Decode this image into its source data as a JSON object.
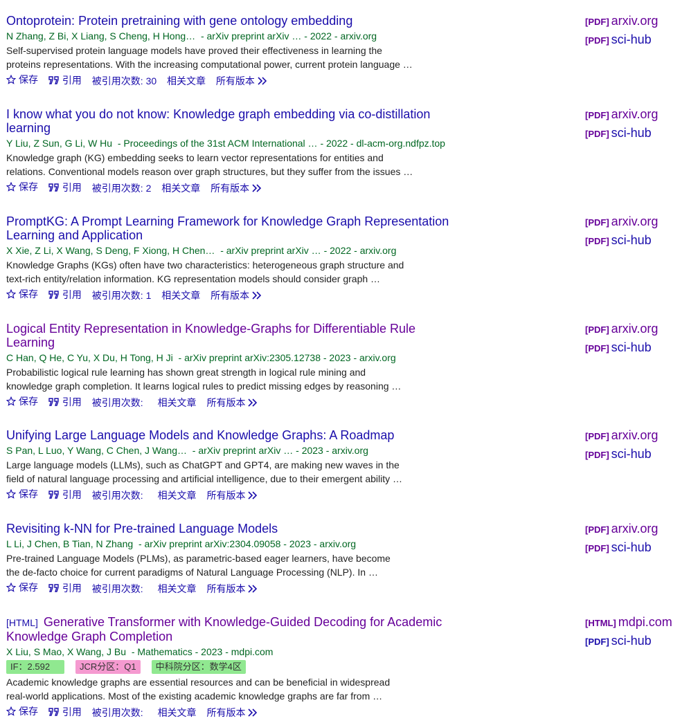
{
  "ui": {
    "save": "保存",
    "cite": "引用",
    "cited_by_prefix": "被引用次数:",
    "related": "相关文章",
    "all_versions": "所有版本",
    "pdf_tag": "[PDF]",
    "html_tag": "[HTML]"
  },
  "results": [
    {
      "title": "Ontoprotein: Protein pretraining with gene ontology embedding",
      "authors": [
        "N Zhang",
        "Z Bi",
        "X Liang",
        "S Cheng",
        "H Hong"
      ],
      "authors_more": "…",
      "source": "- arXiv preprint arXiv … - 2022 - arxiv.org",
      "snippet1": "Self-supervised protein language models have proved their effectiveness in learning the",
      "snippet2": "proteins representations. With the increasing computational power, current protein language …",
      "cited_count": "30",
      "links": [
        {
          "tag": "[PDF]",
          "label": "arxiv.org"
        },
        {
          "tag": "[PDF]",
          "label": "sci-hub"
        }
      ]
    },
    {
      "title": "I know what you do not know: Knowledge graph embedding via co-distillation learning",
      "authors": [
        "Y Liu",
        "Z Sun",
        "G Li",
        "W Hu"
      ],
      "authors_more": "",
      "source": "- Proceedings of the 31st ACM International … - 2022 - dl-acm-org.ndfpz.top",
      "snippet1": "Knowledge graph (KG) embedding seeks to learn vector representations for entities and",
      "snippet2": "relations. Conventional models reason over graph structures, but they suffer from the issues …",
      "cited_count": "2",
      "links": [
        {
          "tag": "[PDF]",
          "label": "arxiv.org"
        },
        {
          "tag": "[PDF]",
          "label": "sci-hub"
        }
      ]
    },
    {
      "title": "PromptKG: A Prompt Learning Framework for Knowledge Graph Representation Learning and Application",
      "authors": [
        "X Xie",
        "Z Li",
        "X Wang",
        "S Deng",
        "F Xiong",
        "H Chen"
      ],
      "authors_more": "…",
      "source": "- arXiv preprint arXiv … - 2022 - arxiv.org",
      "snippet1": "Knowledge Graphs (KGs) often have two characteristics: heterogeneous graph structure and",
      "snippet2": "text-rich entity/relation information. KG representation models should consider graph …",
      "cited_count": "1",
      "links": [
        {
          "tag": "[PDF]",
          "label": "arxiv.org"
        },
        {
          "tag": "[PDF]",
          "label": "sci-hub"
        }
      ]
    },
    {
      "title": "Logical Entity Representation in Knowledge-Graphs for Differentiable Rule Learning",
      "authors": [
        "C Han",
        "Q He",
        "C Yu",
        "X Du",
        "H Tong",
        "H Ji"
      ],
      "authors_more": "",
      "source": "- arXiv preprint arXiv:2305.12738 - 2023 - arxiv.org",
      "snippet1": "Probabilistic logical rule learning has shown great strength in logical rule mining and",
      "snippet2": "knowledge graph completion. It learns logical rules to predict missing edges by reasoning …",
      "cited_count": "",
      "links": [
        {
          "tag": "[PDF]",
          "label": "arxiv.org"
        },
        {
          "tag": "[PDF]",
          "label": "sci-hub"
        }
      ]
    },
    {
      "title": "Unifying Large Language Models and Knowledge Graphs: A Roadmap",
      "authors": [
        "S Pan",
        "L Luo",
        "Y Wang",
        "C Chen",
        "J Wang"
      ],
      "authors_more": "…",
      "source": "- arXiv preprint arXiv … - 2023 - arxiv.org",
      "snippet1": "Large language models (LLMs), such as ChatGPT and GPT4, are making new waves in the",
      "snippet2": "field of natural language processing and artificial intelligence, due to their emergent ability …",
      "cited_count": "",
      "links": [
        {
          "tag": "[PDF]",
          "label": "arxiv.org"
        },
        {
          "tag": "[PDF]",
          "label": "sci-hub"
        }
      ]
    },
    {
      "title": "Revisiting k-NN for Pre-trained Language Models",
      "authors": [
        "L Li",
        "J Chen",
        "B Tian",
        "N Zhang"
      ],
      "authors_more": "",
      "source": "- arXiv preprint arXiv:2304.09058 - 2023 - arxiv.org",
      "snippet1": "Pre-trained Language Models (PLMs), as parametric-based eager learners, have become",
      "snippet2": "the de-facto choice for current paradigms of Natural Language Processing (NLP). In …",
      "cited_count": "",
      "links": [
        {
          "tag": "[PDF]",
          "label": "arxiv.org"
        },
        {
          "tag": "[PDF]",
          "label": "sci-hub"
        }
      ]
    },
    {
      "title_tag": "[HTML]",
      "title": "Generative Transformer with Knowledge-Guided Decoding for Academic Knowledge Graph Completion",
      "authors": [
        "X Liu",
        "S Mao",
        "X Wang",
        "J Bu"
      ],
      "authors_more": "",
      "source": "- Mathematics - 2023 - mdpi.com",
      "badges": [
        {
          "label": "IF：2.592",
          "color": "#90e890"
        },
        {
          "label": "JCR分区：Q1",
          "color": "#f59ad0"
        },
        {
          "label": "中科院分区：数学4区",
          "color": "#90e890"
        }
      ],
      "snippet1": "Academic knowledge graphs are essential resources and can be beneficial in widespread",
      "snippet2": "real-world applications. Most of the existing academic knowledge graphs are far from …",
      "cited_count": "",
      "links": [
        {
          "tag": "[HTML]",
          "label": "mdpi.com"
        },
        {
          "tag": "[PDF]",
          "label": "sci-hub"
        }
      ]
    }
  ]
}
